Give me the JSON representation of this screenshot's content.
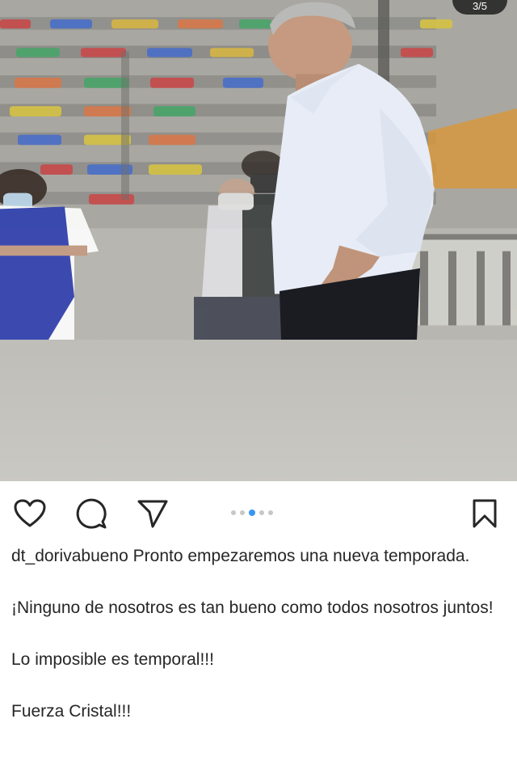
{
  "post": {
    "image_alt": "Entrenador con camisa celeste en el estadio",
    "carousel": {
      "total": 5,
      "active_index": 2
    },
    "counter_badge": "3/5"
  },
  "actions": {
    "like_icon": "heart-outline-icon",
    "comment_icon": "speech-bubble-icon",
    "share_icon": "paper-plane-icon",
    "save_icon": "bookmark-icon"
  },
  "caption": {
    "username": "dt_dorivabueno",
    "line1": "Pronto empezaremos una nueva temporada.",
    "line2": "¡Ninguno de nosotros es tan bueno como todos nosotros juntos!",
    "line3": "Lo imposible es temporal!!!",
    "line4": "Fuerza Cristal!!!"
  },
  "colors": {
    "text": "#262626",
    "carousel_active": "#3897f0",
    "carousel_inactive": "#c7c7c7"
  }
}
